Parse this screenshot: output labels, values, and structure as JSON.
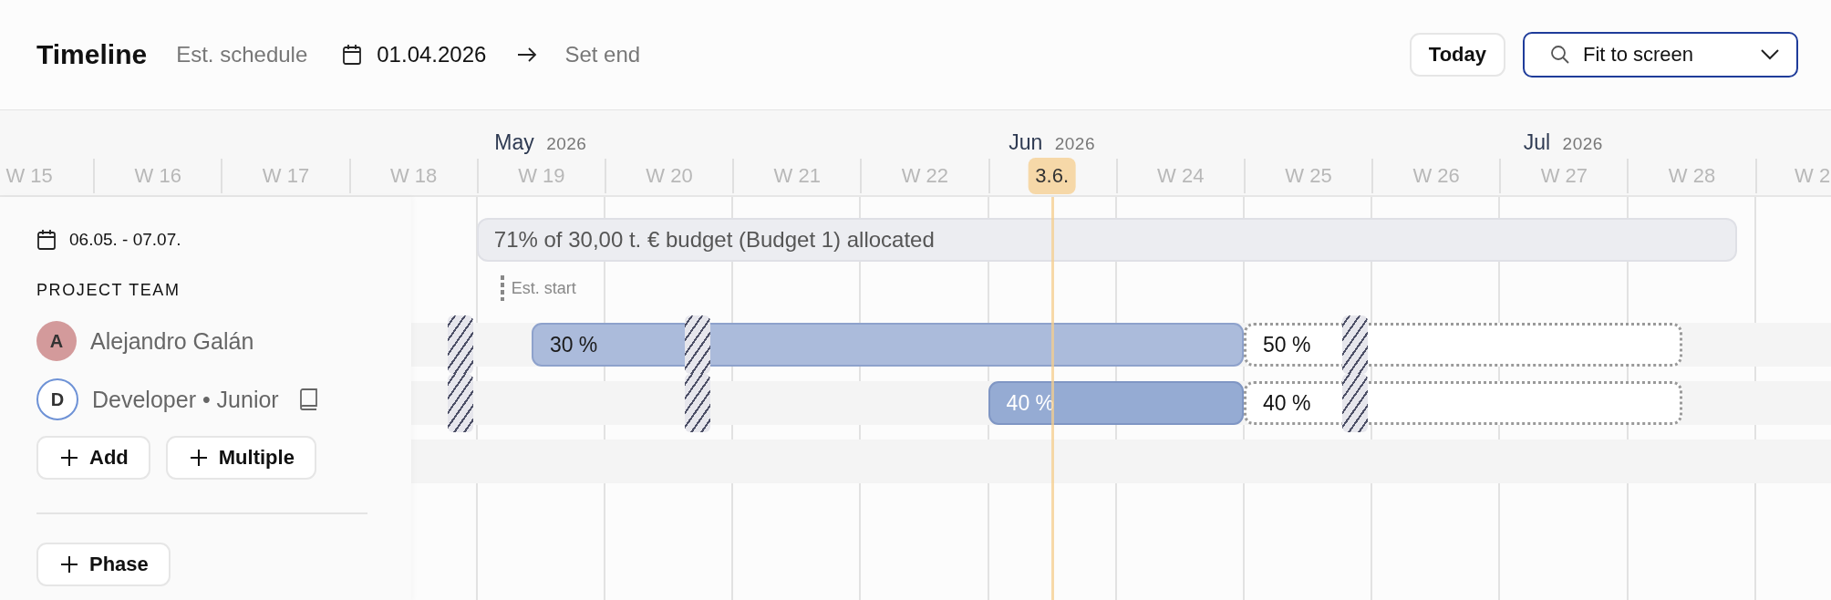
{
  "toolbar": {
    "title": "Timeline",
    "schedule_label": "Est. schedule",
    "start_date": "01.04.2026",
    "end_placeholder": "Set end",
    "today_button": "Today",
    "zoom_select": "Fit to screen"
  },
  "timeline": {
    "weeks": [
      {
        "label": "W 15"
      },
      {
        "label": "W 16"
      },
      {
        "label": "W 17"
      },
      {
        "label": "W 18"
      },
      {
        "label": "W 19",
        "month": "May",
        "year": "2026"
      },
      {
        "label": "W 20"
      },
      {
        "label": "W 21"
      },
      {
        "label": "W 22"
      },
      {
        "month": "Jun",
        "year": "2026"
      },
      {
        "label": "W 24"
      },
      {
        "label": "W 25"
      },
      {
        "label": "W 26"
      },
      {
        "label": "W 27",
        "month": "Jul",
        "year": "2026"
      },
      {
        "label": "W 28"
      },
      {
        "label": "W 2"
      }
    ]
  },
  "today": {
    "label": "3.6."
  },
  "sidebar": {
    "date_range": "06.05. - 07.07.",
    "team_heading": "PROJECT TEAM",
    "members": [
      {
        "name": "Alejandro Galán",
        "initial": "A",
        "kind": "person",
        "book": false,
        "bars": [
          {
            "label": "30 %",
            "kind": "assigned"
          },
          {
            "label": "50 %",
            "kind": "planned"
          }
        ]
      },
      {
        "name": "Developer • Junior",
        "initial": "D",
        "kind": "role",
        "book": true,
        "bars": [
          {
            "label": "40 %",
            "kind": "role"
          },
          {
            "label": "40 %",
            "kind": "planned"
          }
        ]
      }
    ],
    "buttons": [
      {
        "label": "Add"
      },
      {
        "label": "Multiple"
      }
    ],
    "phase_button": "Phase"
  },
  "budget": {
    "text": "71% of 30,00 t. € budget (Budget 1) allocated"
  },
  "est_start": {
    "label": "Est. start"
  },
  "holidays": [
    {
      "kind": "holiday"
    },
    {
      "kind": "holiday"
    },
    {
      "kind": "holiday"
    }
  ]
}
